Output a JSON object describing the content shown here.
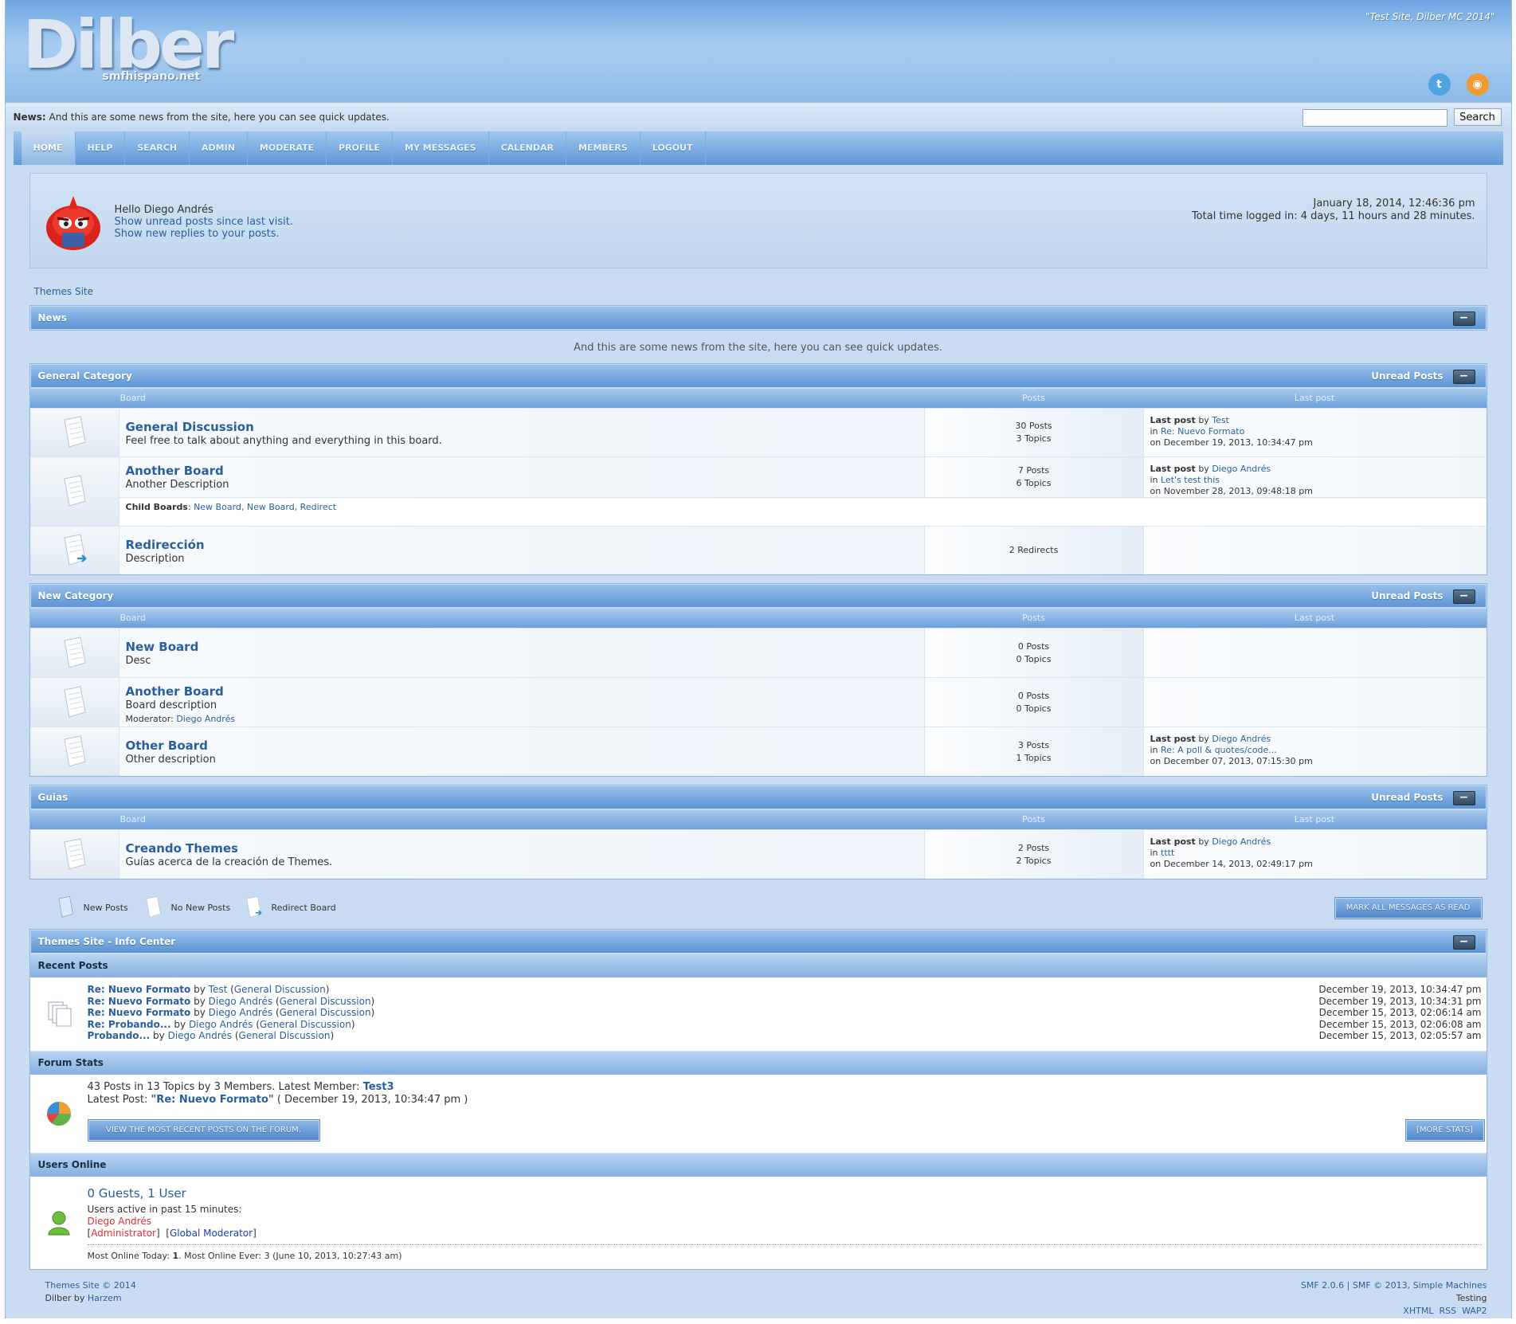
{
  "header": {
    "logo_text": "Dilber",
    "logo_sub": "smfhispano.net",
    "tagline": "\"Test Site, Dilber MC 2014\"",
    "twitter_glyph": "t",
    "rss_glyph": "◉"
  },
  "newsbar": {
    "label": "News:",
    "text": "And this are some news from the site, here you can see quick updates.",
    "search_button": "Search"
  },
  "menu": [
    "HOME",
    "HELP",
    "SEARCH",
    "ADMIN",
    "MODERATE",
    "PROFILE",
    "MY MESSAGES",
    "CALENDAR",
    "MEMBERS",
    "LOGOUT"
  ],
  "user": {
    "hello": "Hello Diego Andrés",
    "unread_link": "Show unread posts since last visit.",
    "replies_link": "Show new replies to your posts.",
    "date": "January 18, 2014, 12:46:36 pm",
    "time_logged": "Total time logged in: 4 days, 11 hours and 28 minutes."
  },
  "breadcrumb": "Themes Site",
  "news": {
    "title": "News",
    "text": "And this are some news from the site, here you can see quick updates."
  },
  "columns": {
    "board": "Board",
    "posts": "Posts",
    "last_post": "Last post"
  },
  "labels": {
    "unread_posts": "Unread Posts",
    "last_post": "Last post",
    "by": "by",
    "in": "in",
    "child_boards": "Child Boards",
    "moderator": "Moderator:",
    "collapse": "−"
  },
  "categories": [
    {
      "title": "General Category",
      "boards": [
        {
          "name": "General Discussion",
          "desc": "Feel free to talk about anything and everything in this board.",
          "posts": "30 Posts",
          "topics": "3 Topics",
          "last_by": "Test",
          "last_in": "Re: Nuevo Formato",
          "last_on": "on December 19, 2013, 10:34:47 pm"
        },
        {
          "name": "Another Board",
          "desc": "Another Description",
          "posts": "7 Posts",
          "topics": "6 Topics",
          "last_by": "Diego Andrés",
          "last_in": "Let's test this",
          "last_on": "on November 28, 2013, 09:48:18 pm",
          "child_boards": "New Board, New Board, Redirect"
        },
        {
          "name": "Redirección",
          "desc": "Description",
          "posts": "2 Redirects"
        }
      ]
    },
    {
      "title": "New Category",
      "boards": [
        {
          "name": "New Board",
          "desc": "Desc",
          "posts": "0 Posts",
          "topics": "0 Topics"
        },
        {
          "name": "Another Board",
          "desc": "Board description",
          "posts": "0 Posts",
          "topics": "0 Topics",
          "moderator": "Diego Andrés"
        },
        {
          "name": "Other Board",
          "desc": "Other description",
          "posts": "3 Posts",
          "topics": "1 Topics",
          "last_by": "Diego Andrés",
          "last_in": "Re: A poll & quotes/code...",
          "last_on": "on December 07, 2013, 07:15:30 pm"
        }
      ]
    },
    {
      "title": "Guias",
      "boards": [
        {
          "name": "Creando Themes",
          "desc": "Guías acerca de la creación de Themes.",
          "posts": "2 Posts",
          "topics": "2 Topics",
          "last_by": "Diego Andrés",
          "last_in": "tttt",
          "last_on": "on December 14, 2013, 02:49:17 pm"
        }
      ]
    }
  ],
  "legend": {
    "new_posts": "New Posts",
    "no_new_posts": "No New Posts",
    "redirect": "Redirect Board",
    "mark_read": "MARK ALL MESSAGES AS READ"
  },
  "info_center": {
    "title": "Themes Site - Info Center",
    "recent_title": "Recent Posts",
    "recent": [
      {
        "subject": "Re: Nuevo Formato",
        "by": "by",
        "author": "Test",
        "board": "General Discussion",
        "date": "December 19, 2013, 10:34:47 pm"
      },
      {
        "subject": "Re: Nuevo Formato",
        "by": "by",
        "author": "Diego Andrés",
        "board": "General Discussion",
        "date": "December 19, 2013, 10:34:31 pm"
      },
      {
        "subject": "Re: Nuevo Formato",
        "by": "by",
        "author": "Diego Andrés",
        "board": "General Discussion",
        "date": "December 15, 2013, 02:06:14 am"
      },
      {
        "subject": "Re: Probando...",
        "by": "by",
        "author": "Diego Andrés",
        "board": "General Discussion",
        "date": "December 15, 2013, 02:06:08 am"
      },
      {
        "subject": "Probando...",
        "by": "by",
        "author": "Diego Andrés",
        "board": "General Discussion",
        "date": "December 15, 2013, 02:05:57 am"
      }
    ],
    "stats_title": "Forum Stats",
    "stats_line": "43 Posts in 13 Topics by 3 Members. Latest Member:",
    "latest_member": "Test3",
    "latest_post_label": "Latest Post:",
    "latest_post": "\"Re: Nuevo Formato\"",
    "latest_post_date": "( December 19, 2013, 10:34:47 pm )",
    "recent_btn": "VIEW THE MOST RECENT POSTS ON THE FORUM.",
    "more_stats": "[MORE STATS]",
    "online_title": "Users Online",
    "online_count": "0 Guests, 1 User",
    "online_active": "Users active in past 15 minutes:",
    "online_user": "Diego Andrés",
    "group_admin": "Administrator",
    "group_gmod": "Global Moderator",
    "most_online_prefix": "Most Online Today:",
    "most_online_today": "1",
    "most_online_ever": ". Most Online Ever: 3 (June 10, 2013, 10:27:43 am)"
  },
  "footer": {
    "copy": "Themes Site © 2014",
    "theme_by": "Dilber by",
    "theme_author": "Harzem",
    "smf": "SMF 2.0.6 | SMF © 2013, Simple Machines",
    "testing": "Testing",
    "xhtml": "XHTML",
    "rss": "RSS",
    "wap2": "WAP2"
  },
  "colors": {
    "link": "#2a5f9e",
    "admin": "#e03030",
    "gmod": "#1a3fb0",
    "twitter": "#4fa3de",
    "rss": "#ef9b33"
  }
}
